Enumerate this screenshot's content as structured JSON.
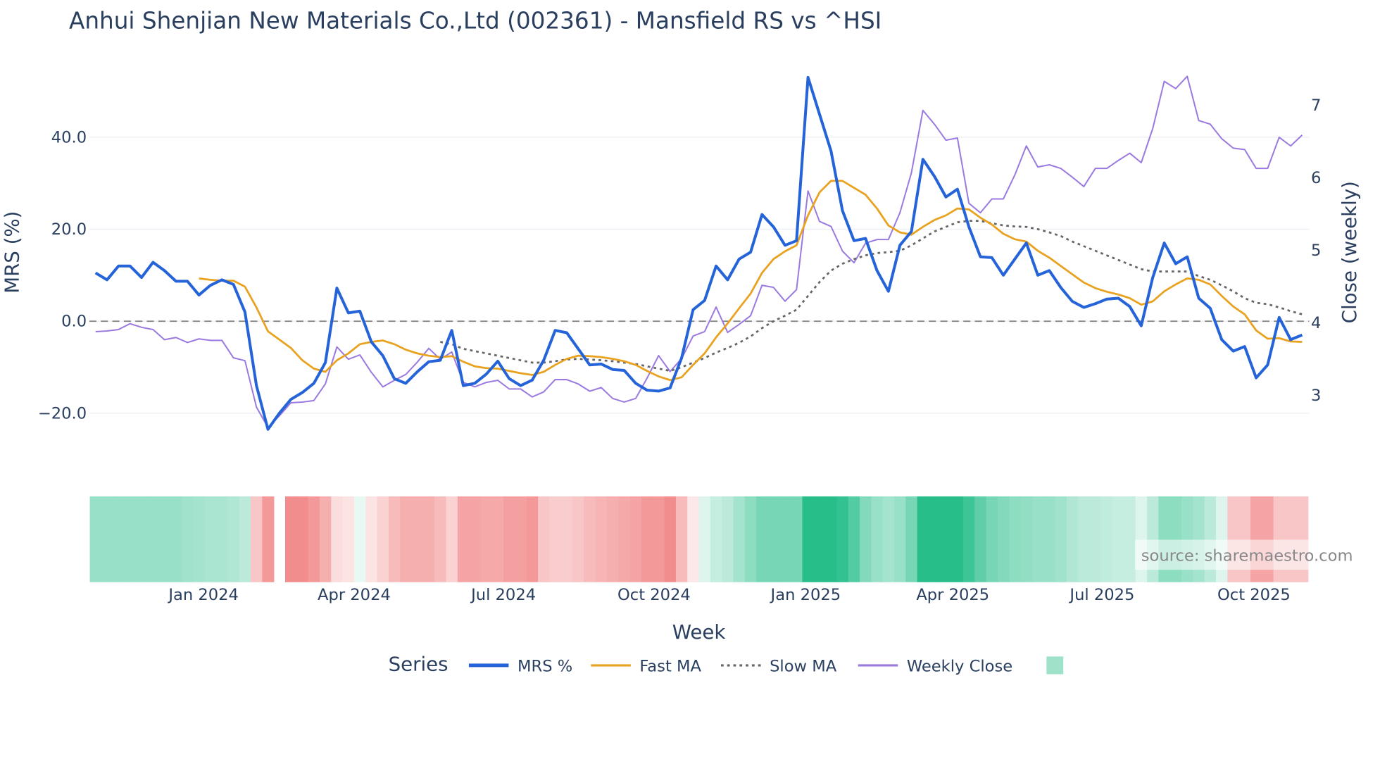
{
  "chart_data": {
    "type": "line",
    "title": "Anhui Shenjian New Materials Co.,Ltd (002361) - Mansfield RS vs ^HSI",
    "xlabel": "Week",
    "ylabel": "MRS (%)",
    "y2label": "Close (weekly)",
    "ylim": [
      -28,
      58
    ],
    "y2lim": [
      2.4,
      7.6
    ],
    "yticks": [
      "40.0",
      "20.0",
      "0.0",
      "−20.0"
    ],
    "ytick_values": [
      40,
      20,
      0,
      -20
    ],
    "y2ticks": [
      "7",
      "6",
      "5",
      "4",
      "3"
    ],
    "y2tick_values": [
      7,
      6,
      5,
      4,
      3
    ],
    "xticks": [
      "Jan 2024",
      "Apr 2024",
      "Jul 2024",
      "Oct 2024",
      "Jan 2025",
      "Apr 2025",
      "Jul 2025",
      "Oct 2025"
    ],
    "xtick_week_index": [
      9.4,
      22.5,
      35.5,
      48.6,
      61.8,
      74.6,
      87.6,
      100.8
    ],
    "n_weeks": 106,
    "legend": {
      "title": "Series",
      "placement": "bottom"
    },
    "series": [
      {
        "name": "MRS %",
        "axis": "left",
        "color": "#2563d9",
        "start": 0,
        "values": [
          10.5,
          9,
          12,
          12,
          9.5,
          12.8,
          11,
          8.7,
          8.7,
          5.7,
          7.8,
          9,
          8,
          2,
          -14,
          -23.5,
          -20,
          -17,
          -15.5,
          -13.5,
          -9,
          7.2,
          1.8,
          2.2,
          -4.5,
          -7.5,
          -12.5,
          -13.5,
          -11,
          -8.8,
          -8.5,
          -2,
          -14,
          -13.5,
          -11.5,
          -8.7,
          -12.5,
          -14,
          -12.8,
          -8.5,
          -2,
          -2.5,
          -6,
          -9.5,
          -9.3,
          -10.5,
          -10.7,
          -13.5,
          -15,
          -15.2,
          -14.5,
          -8,
          2.5,
          4.5,
          12,
          9,
          13.5,
          15,
          23.2,
          20.5,
          16.5,
          17.5,
          53,
          45,
          37,
          24,
          17.5,
          18,
          11,
          6.5,
          16.5,
          19.5,
          35.2,
          31.5,
          27,
          28.7,
          20.5,
          14,
          13.8,
          10,
          13.5,
          17,
          10,
          11,
          7.3,
          4.3,
          3,
          3.8,
          4.8,
          5,
          3.2,
          -1,
          9.5,
          17,
          12.5,
          14,
          5,
          2.8,
          -4,
          -6.5,
          -5.5,
          -12.3,
          -9.5,
          0.8,
          -4,
          -3
        ]
      },
      {
        "name": "Fast MA",
        "axis": "left",
        "color": "#e8a21f",
        "start": 9,
        "values": [
          9.3,
          9,
          8.8,
          8.8,
          7.5,
          3,
          -2.2,
          -4,
          -5.8,
          -8.5,
          -10.3,
          -11,
          -8.5,
          -7,
          -5,
          -4.5,
          -4.2,
          -5,
          -6.2,
          -7,
          -7.5,
          -7.8,
          -7.6,
          -8.8,
          -9.8,
          -10.2,
          -10.3,
          -10.8,
          -11.3,
          -11.7,
          -11,
          -9.5,
          -8.2,
          -7.5,
          -7.6,
          -7.8,
          -8.2,
          -8.7,
          -9.5,
          -10.8,
          -12,
          -12.8,
          -12.2,
          -9.5,
          -7,
          -3.5,
          -0.5,
          2.8,
          6,
          10.5,
          13.5,
          15.2,
          16.5,
          23,
          28,
          30.5,
          30.5,
          29,
          27.5,
          24.5,
          20.8,
          19.3,
          18.8,
          20.5,
          22,
          23,
          24.5,
          24.3,
          22.5,
          21,
          19,
          17.8,
          17.3,
          15.3,
          13.8,
          12,
          10.2,
          8.4,
          7.2,
          6.4,
          5.8,
          5,
          3.6,
          4.3,
          6.5,
          8,
          9.3,
          9,
          8,
          5.5,
          3.2,
          1.5,
          -2,
          -3.8,
          -3.7,
          -4.4,
          -4.5
        ]
      },
      {
        "name": "Slow MA",
        "axis": "left",
        "color": "#666666",
        "dash": true,
        "start": 30,
        "values": [
          -4.5,
          -5,
          -6,
          -6.5,
          -7,
          -7.5,
          -8,
          -8.5,
          -9,
          -9,
          -8.7,
          -8.3,
          -8.2,
          -8.3,
          -8.5,
          -8.7,
          -9,
          -9.3,
          -9.8,
          -10.3,
          -10.8,
          -10,
          -9,
          -8,
          -6.8,
          -5.8,
          -4.7,
          -3.3,
          -1.5,
          0,
          1.2,
          2.5,
          5.5,
          8.5,
          11,
          12.5,
          13.5,
          14.3,
          14.8,
          15,
          15.3,
          16.5,
          18,
          19.5,
          20.5,
          21.5,
          21.8,
          21.8,
          21.3,
          20.8,
          20.6,
          20.5,
          20,
          19.3,
          18.5,
          17.3,
          16.3,
          15.3,
          14.3,
          13.3,
          12.3,
          11.3,
          10.8,
          10.8,
          10.8,
          10.8,
          9.8,
          9,
          7.8,
          6.5,
          5,
          4,
          3.7,
          3,
          2.2,
          1.5
        ]
      },
      {
        "name": "Weekly Close",
        "axis": "right",
        "color": "#9b7ae0",
        "start": 0,
        "values": [
          3.88,
          3.89,
          3.91,
          3.99,
          3.94,
          3.91,
          3.77,
          3.8,
          3.73,
          3.78,
          3.76,
          3.76,
          3.52,
          3.48,
          2.84,
          2.56,
          2.72,
          2.9,
          2.91,
          2.93,
          3.16,
          3.67,
          3.5,
          3.56,
          3.32,
          3.12,
          3.21,
          3.29,
          3.46,
          3.65,
          3.5,
          3.6,
          3.18,
          3.12,
          3.18,
          3.21,
          3.09,
          3.09,
          2.98,
          3.05,
          3.22,
          3.22,
          3.16,
          3.06,
          3.11,
          2.96,
          2.91,
          2.96,
          3.24,
          3.55,
          3.33,
          3.51,
          3.82,
          3.88,
          4.22,
          3.87,
          3.98,
          4.1,
          4.52,
          4.49,
          4.3,
          4.46,
          5.82,
          5.4,
          5.33,
          4.99,
          4.83,
          5.1,
          5.15,
          5.15,
          5.52,
          6.07,
          6.93,
          6.74,
          6.52,
          6.55,
          5.65,
          5.52,
          5.71,
          5.71,
          6.04,
          6.44,
          6.15,
          6.18,
          6.13,
          6.01,
          5.88,
          6.13,
          6.13,
          6.24,
          6.34,
          6.21,
          6.68,
          7.33,
          7.23,
          7.4,
          6.79,
          6.74,
          6.54,
          6.41,
          6.39,
          6.13,
          6.13,
          6.56,
          6.44,
          6.59
        ]
      }
    ],
    "heatmap": {
      "legend_color": "#9ee3c9",
      "positive_color": "#27be8a",
      "negative_color": "#f08282",
      "values": [
        0.45,
        0.45,
        0.45,
        0.45,
        0.45,
        0.45,
        0.45,
        0.45,
        0.42,
        0.4,
        0.38,
        0.38,
        0.35,
        0.3,
        -0.25,
        -0.45,
        null,
        -0.5,
        -0.5,
        -0.45,
        -0.35,
        -0.15,
        -0.12,
        0.1,
        -0.12,
        -0.2,
        -0.3,
        -0.35,
        -0.35,
        -0.35,
        -0.3,
        -0.2,
        -0.4,
        -0.4,
        -0.38,
        -0.38,
        -0.42,
        -0.42,
        -0.45,
        -0.25,
        -0.22,
        -0.22,
        -0.25,
        -0.3,
        -0.33,
        -0.35,
        -0.38,
        -0.4,
        -0.45,
        -0.45,
        -0.5,
        -0.3,
        -0.1,
        0.15,
        0.25,
        0.3,
        0.4,
        0.5,
        0.6,
        0.6,
        0.6,
        0.6,
        0.95,
        0.95,
        0.95,
        0.9,
        0.75,
        0.55,
        0.45,
        0.4,
        0.45,
        0.6,
        0.95,
        0.95,
        0.95,
        0.95,
        0.85,
        0.7,
        0.6,
        0.55,
        0.5,
        0.48,
        0.45,
        0.45,
        0.42,
        0.35,
        0.3,
        0.3,
        0.28,
        0.25,
        0.25,
        0.15,
        0.3,
        0.5,
        0.5,
        0.45,
        0.4,
        0.3,
        0.15,
        -0.25,
        -0.25,
        -0.4,
        -0.4,
        -0.25,
        -0.25,
        -0.25
      ]
    },
    "reference_line": 0,
    "watermark": "source: sharemaestro.com"
  }
}
